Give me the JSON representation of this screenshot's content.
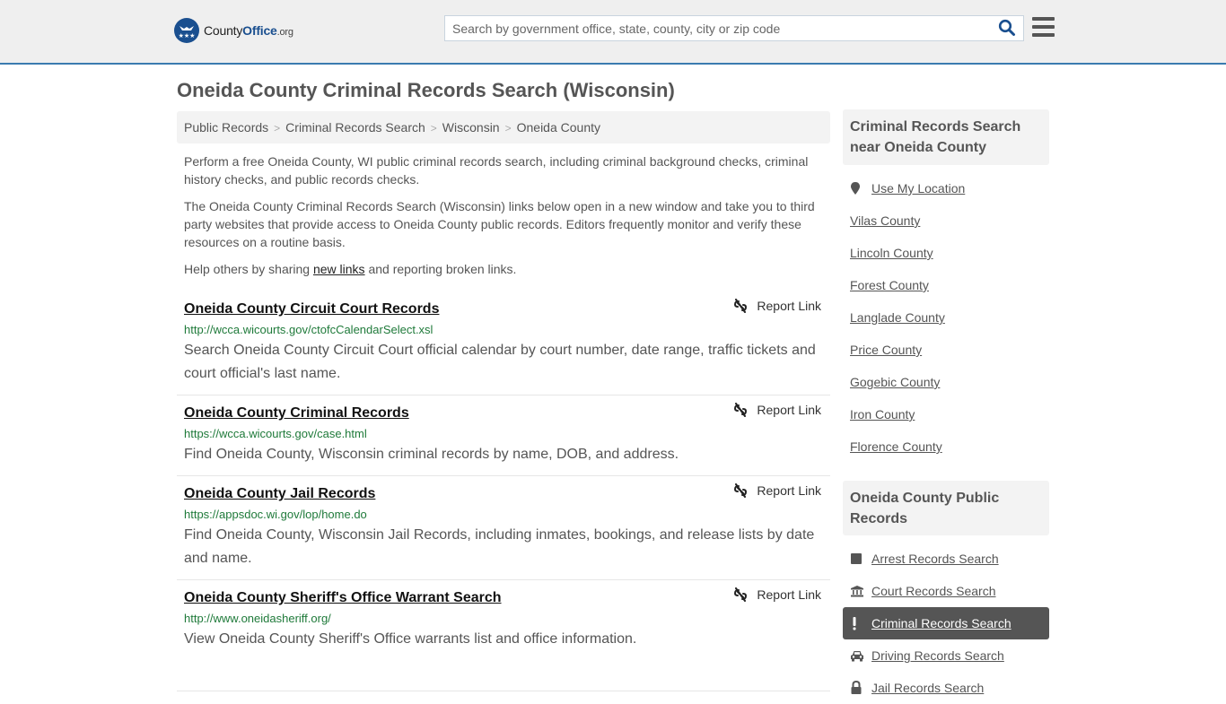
{
  "header": {
    "logo": {
      "name": "County",
      "name_bold": "Office",
      "tld": ".org"
    },
    "search": {
      "placeholder": "Search by government office, state, county, city or zip code",
      "value": ""
    },
    "colors": {
      "brand": "#1a4f8f",
      "header_border": "#3a7bb0"
    }
  },
  "main": {
    "title": "Oneida County Criminal Records Search (Wisconsin)",
    "breadcrumb": [
      "Public Records",
      "Criminal Records Search",
      "Wisconsin",
      "Oneida County"
    ],
    "intro": {
      "p1": "Perform a free Oneida County, WI public criminal records search, including criminal background checks, criminal history checks, and public records checks.",
      "p2": "The Oneida County Criminal Records Search (Wisconsin) links below open in a new window and take you to third party websites that provide access to Oneida County public records. Editors frequently monitor and verify these resources on a routine basis.",
      "p3_before": "Help others by sharing ",
      "p3_link": "new links",
      "p3_after": " and reporting broken links."
    },
    "report_label": "Report Link",
    "records": [
      {
        "title": "Oneida County Circuit Court Records",
        "url": "http://wcca.wicourts.gov/ctofcCalendarSelect.xsl",
        "description": "Search Oneida County Circuit Court official calendar by court number, date range, traffic tickets and court official's last name."
      },
      {
        "title": "Oneida County Criminal Records",
        "url": "https://wcca.wicourts.gov/case.html",
        "description": "Find Oneida County, Wisconsin criminal records by name, DOB, and address."
      },
      {
        "title": "Oneida County Jail Records",
        "url": "https://appsdoc.wi.gov/lop/home.do",
        "description": "Find Oneida County, Wisconsin Jail Records, including inmates, bookings, and release lists by date and name."
      },
      {
        "title": "Oneida County Sheriff's Office Warrant Search",
        "url": "http://www.oneidasheriff.org/",
        "description": "View Oneida County Sheriff's Office warrants list and office information."
      }
    ]
  },
  "sidebar": {
    "nearby": {
      "heading": "Criminal Records Search near Oneida County",
      "use_location": "Use My Location",
      "counties": [
        "Vilas County",
        "Lincoln County",
        "Forest County",
        "Langlade County",
        "Price County",
        "Gogebic County",
        "Iron County",
        "Florence County"
      ]
    },
    "public_records": {
      "heading": "Oneida County Public Records",
      "items": [
        {
          "label": "Arrest Records Search",
          "icon": "square-icon",
          "active": false
        },
        {
          "label": "Court Records Search",
          "icon": "courthouse-icon",
          "active": false
        },
        {
          "label": "Criminal Records Search",
          "icon": "exclamation-icon",
          "active": true
        },
        {
          "label": "Driving Records Search",
          "icon": "car-icon",
          "active": false
        },
        {
          "label": "Jail Records Search",
          "icon": "lock-icon",
          "active": false
        }
      ]
    }
  }
}
